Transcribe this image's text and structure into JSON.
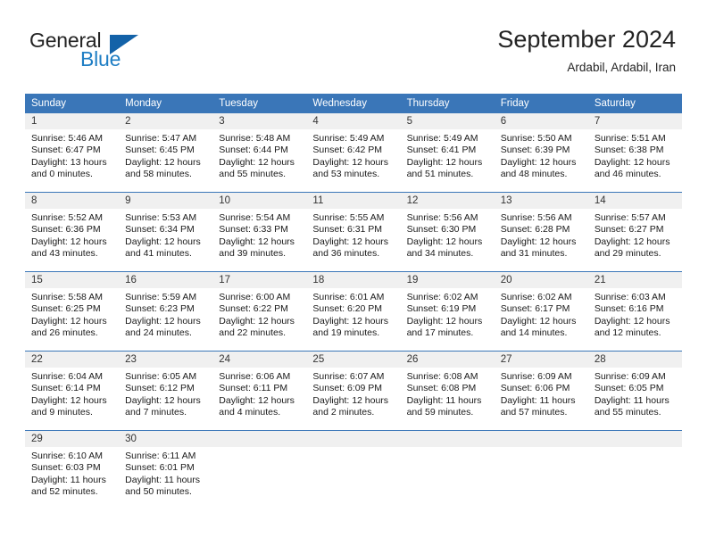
{
  "brand": {
    "name_top": "General",
    "name_bottom": "Blue"
  },
  "header": {
    "title": "September 2024",
    "location": "Ardabil, Ardabil, Iran"
  },
  "colors": {
    "header_blue": "#3a76b8",
    "logo_blue": "#1f7ec4",
    "daynum_band": "#f0f0f0",
    "text": "#1a1a1a"
  },
  "weekday_headers": [
    "Sunday",
    "Monday",
    "Tuesday",
    "Wednesday",
    "Thursday",
    "Friday",
    "Saturday"
  ],
  "weeks": [
    [
      {
        "day": "1",
        "sunrise": "Sunrise: 5:46 AM",
        "sunset": "Sunset: 6:47 PM",
        "daylight": "Daylight: 13 hours and 0 minutes."
      },
      {
        "day": "2",
        "sunrise": "Sunrise: 5:47 AM",
        "sunset": "Sunset: 6:45 PM",
        "daylight": "Daylight: 12 hours and 58 minutes."
      },
      {
        "day": "3",
        "sunrise": "Sunrise: 5:48 AM",
        "sunset": "Sunset: 6:44 PM",
        "daylight": "Daylight: 12 hours and 55 minutes."
      },
      {
        "day": "4",
        "sunrise": "Sunrise: 5:49 AM",
        "sunset": "Sunset: 6:42 PM",
        "daylight": "Daylight: 12 hours and 53 minutes."
      },
      {
        "day": "5",
        "sunrise": "Sunrise: 5:49 AM",
        "sunset": "Sunset: 6:41 PM",
        "daylight": "Daylight: 12 hours and 51 minutes."
      },
      {
        "day": "6",
        "sunrise": "Sunrise: 5:50 AM",
        "sunset": "Sunset: 6:39 PM",
        "daylight": "Daylight: 12 hours and 48 minutes."
      },
      {
        "day": "7",
        "sunrise": "Sunrise: 5:51 AM",
        "sunset": "Sunset: 6:38 PM",
        "daylight": "Daylight: 12 hours and 46 minutes."
      }
    ],
    [
      {
        "day": "8",
        "sunrise": "Sunrise: 5:52 AM",
        "sunset": "Sunset: 6:36 PM",
        "daylight": "Daylight: 12 hours and 43 minutes."
      },
      {
        "day": "9",
        "sunrise": "Sunrise: 5:53 AM",
        "sunset": "Sunset: 6:34 PM",
        "daylight": "Daylight: 12 hours and 41 minutes."
      },
      {
        "day": "10",
        "sunrise": "Sunrise: 5:54 AM",
        "sunset": "Sunset: 6:33 PM",
        "daylight": "Daylight: 12 hours and 39 minutes."
      },
      {
        "day": "11",
        "sunrise": "Sunrise: 5:55 AM",
        "sunset": "Sunset: 6:31 PM",
        "daylight": "Daylight: 12 hours and 36 minutes."
      },
      {
        "day": "12",
        "sunrise": "Sunrise: 5:56 AM",
        "sunset": "Sunset: 6:30 PM",
        "daylight": "Daylight: 12 hours and 34 minutes."
      },
      {
        "day": "13",
        "sunrise": "Sunrise: 5:56 AM",
        "sunset": "Sunset: 6:28 PM",
        "daylight": "Daylight: 12 hours and 31 minutes."
      },
      {
        "day": "14",
        "sunrise": "Sunrise: 5:57 AM",
        "sunset": "Sunset: 6:27 PM",
        "daylight": "Daylight: 12 hours and 29 minutes."
      }
    ],
    [
      {
        "day": "15",
        "sunrise": "Sunrise: 5:58 AM",
        "sunset": "Sunset: 6:25 PM",
        "daylight": "Daylight: 12 hours and 26 minutes."
      },
      {
        "day": "16",
        "sunrise": "Sunrise: 5:59 AM",
        "sunset": "Sunset: 6:23 PM",
        "daylight": "Daylight: 12 hours and 24 minutes."
      },
      {
        "day": "17",
        "sunrise": "Sunrise: 6:00 AM",
        "sunset": "Sunset: 6:22 PM",
        "daylight": "Daylight: 12 hours and 22 minutes."
      },
      {
        "day": "18",
        "sunrise": "Sunrise: 6:01 AM",
        "sunset": "Sunset: 6:20 PM",
        "daylight": "Daylight: 12 hours and 19 minutes."
      },
      {
        "day": "19",
        "sunrise": "Sunrise: 6:02 AM",
        "sunset": "Sunset: 6:19 PM",
        "daylight": "Daylight: 12 hours and 17 minutes."
      },
      {
        "day": "20",
        "sunrise": "Sunrise: 6:02 AM",
        "sunset": "Sunset: 6:17 PM",
        "daylight": "Daylight: 12 hours and 14 minutes."
      },
      {
        "day": "21",
        "sunrise": "Sunrise: 6:03 AM",
        "sunset": "Sunset: 6:16 PM",
        "daylight": "Daylight: 12 hours and 12 minutes."
      }
    ],
    [
      {
        "day": "22",
        "sunrise": "Sunrise: 6:04 AM",
        "sunset": "Sunset: 6:14 PM",
        "daylight": "Daylight: 12 hours and 9 minutes."
      },
      {
        "day": "23",
        "sunrise": "Sunrise: 6:05 AM",
        "sunset": "Sunset: 6:12 PM",
        "daylight": "Daylight: 12 hours and 7 minutes."
      },
      {
        "day": "24",
        "sunrise": "Sunrise: 6:06 AM",
        "sunset": "Sunset: 6:11 PM",
        "daylight": "Daylight: 12 hours and 4 minutes."
      },
      {
        "day": "25",
        "sunrise": "Sunrise: 6:07 AM",
        "sunset": "Sunset: 6:09 PM",
        "daylight": "Daylight: 12 hours and 2 minutes."
      },
      {
        "day": "26",
        "sunrise": "Sunrise: 6:08 AM",
        "sunset": "Sunset: 6:08 PM",
        "daylight": "Daylight: 11 hours and 59 minutes."
      },
      {
        "day": "27",
        "sunrise": "Sunrise: 6:09 AM",
        "sunset": "Sunset: 6:06 PM",
        "daylight": "Daylight: 11 hours and 57 minutes."
      },
      {
        "day": "28",
        "sunrise": "Sunrise: 6:09 AM",
        "sunset": "Sunset: 6:05 PM",
        "daylight": "Daylight: 11 hours and 55 minutes."
      }
    ],
    [
      {
        "day": "29",
        "sunrise": "Sunrise: 6:10 AM",
        "sunset": "Sunset: 6:03 PM",
        "daylight": "Daylight: 11 hours and 52 minutes."
      },
      {
        "day": "30",
        "sunrise": "Sunrise: 6:11 AM",
        "sunset": "Sunset: 6:01 PM",
        "daylight": "Daylight: 11 hours and 50 minutes."
      },
      {
        "day": "",
        "sunrise": "",
        "sunset": "",
        "daylight": ""
      },
      {
        "day": "",
        "sunrise": "",
        "sunset": "",
        "daylight": ""
      },
      {
        "day": "",
        "sunrise": "",
        "sunset": "",
        "daylight": ""
      },
      {
        "day": "",
        "sunrise": "",
        "sunset": "",
        "daylight": ""
      },
      {
        "day": "",
        "sunrise": "",
        "sunset": "",
        "daylight": ""
      }
    ]
  ]
}
